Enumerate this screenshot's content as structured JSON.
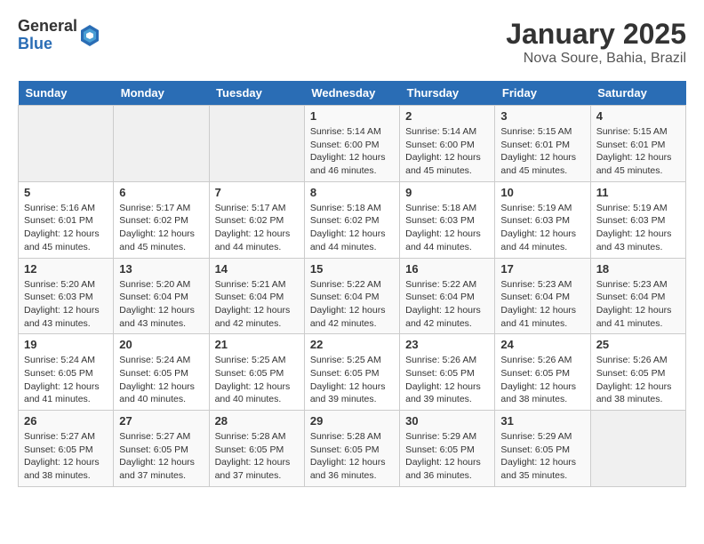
{
  "header": {
    "logo": {
      "general": "General",
      "blue": "Blue"
    },
    "title": "January 2025",
    "location": "Nova Soure, Bahia, Brazil"
  },
  "calendar": {
    "days_of_week": [
      "Sunday",
      "Monday",
      "Tuesday",
      "Wednesday",
      "Thursday",
      "Friday",
      "Saturday"
    ],
    "weeks": [
      {
        "days": [
          {
            "number": "",
            "empty": true
          },
          {
            "number": "",
            "empty": true
          },
          {
            "number": "",
            "empty": true
          },
          {
            "number": "1",
            "sunrise": "5:14 AM",
            "sunset": "6:00 PM",
            "daylight": "12 hours and 46 minutes."
          },
          {
            "number": "2",
            "sunrise": "5:14 AM",
            "sunset": "6:00 PM",
            "daylight": "12 hours and 45 minutes."
          },
          {
            "number": "3",
            "sunrise": "5:15 AM",
            "sunset": "6:01 PM",
            "daylight": "12 hours and 45 minutes."
          },
          {
            "number": "4",
            "sunrise": "5:15 AM",
            "sunset": "6:01 PM",
            "daylight": "12 hours and 45 minutes."
          }
        ]
      },
      {
        "days": [
          {
            "number": "5",
            "sunrise": "5:16 AM",
            "sunset": "6:01 PM",
            "daylight": "12 hours and 45 minutes."
          },
          {
            "number": "6",
            "sunrise": "5:17 AM",
            "sunset": "6:02 PM",
            "daylight": "12 hours and 45 minutes."
          },
          {
            "number": "7",
            "sunrise": "5:17 AM",
            "sunset": "6:02 PM",
            "daylight": "12 hours and 44 minutes."
          },
          {
            "number": "8",
            "sunrise": "5:18 AM",
            "sunset": "6:02 PM",
            "daylight": "12 hours and 44 minutes."
          },
          {
            "number": "9",
            "sunrise": "5:18 AM",
            "sunset": "6:03 PM",
            "daylight": "12 hours and 44 minutes."
          },
          {
            "number": "10",
            "sunrise": "5:19 AM",
            "sunset": "6:03 PM",
            "daylight": "12 hours and 44 minutes."
          },
          {
            "number": "11",
            "sunrise": "5:19 AM",
            "sunset": "6:03 PM",
            "daylight": "12 hours and 43 minutes."
          }
        ]
      },
      {
        "days": [
          {
            "number": "12",
            "sunrise": "5:20 AM",
            "sunset": "6:03 PM",
            "daylight": "12 hours and 43 minutes."
          },
          {
            "number": "13",
            "sunrise": "5:20 AM",
            "sunset": "6:04 PM",
            "daylight": "12 hours and 43 minutes."
          },
          {
            "number": "14",
            "sunrise": "5:21 AM",
            "sunset": "6:04 PM",
            "daylight": "12 hours and 42 minutes."
          },
          {
            "number": "15",
            "sunrise": "5:22 AM",
            "sunset": "6:04 PM",
            "daylight": "12 hours and 42 minutes."
          },
          {
            "number": "16",
            "sunrise": "5:22 AM",
            "sunset": "6:04 PM",
            "daylight": "12 hours and 42 minutes."
          },
          {
            "number": "17",
            "sunrise": "5:23 AM",
            "sunset": "6:04 PM",
            "daylight": "12 hours and 41 minutes."
          },
          {
            "number": "18",
            "sunrise": "5:23 AM",
            "sunset": "6:04 PM",
            "daylight": "12 hours and 41 minutes."
          }
        ]
      },
      {
        "days": [
          {
            "number": "19",
            "sunrise": "5:24 AM",
            "sunset": "6:05 PM",
            "daylight": "12 hours and 41 minutes."
          },
          {
            "number": "20",
            "sunrise": "5:24 AM",
            "sunset": "6:05 PM",
            "daylight": "12 hours and 40 minutes."
          },
          {
            "number": "21",
            "sunrise": "5:25 AM",
            "sunset": "6:05 PM",
            "daylight": "12 hours and 40 minutes."
          },
          {
            "number": "22",
            "sunrise": "5:25 AM",
            "sunset": "6:05 PM",
            "daylight": "12 hours and 39 minutes."
          },
          {
            "number": "23",
            "sunrise": "5:26 AM",
            "sunset": "6:05 PM",
            "daylight": "12 hours and 39 minutes."
          },
          {
            "number": "24",
            "sunrise": "5:26 AM",
            "sunset": "6:05 PM",
            "daylight": "12 hours and 38 minutes."
          },
          {
            "number": "25",
            "sunrise": "5:26 AM",
            "sunset": "6:05 PM",
            "daylight": "12 hours and 38 minutes."
          }
        ]
      },
      {
        "days": [
          {
            "number": "26",
            "sunrise": "5:27 AM",
            "sunset": "6:05 PM",
            "daylight": "12 hours and 38 minutes."
          },
          {
            "number": "27",
            "sunrise": "5:27 AM",
            "sunset": "6:05 PM",
            "daylight": "12 hours and 37 minutes."
          },
          {
            "number": "28",
            "sunrise": "5:28 AM",
            "sunset": "6:05 PM",
            "daylight": "12 hours and 37 minutes."
          },
          {
            "number": "29",
            "sunrise": "5:28 AM",
            "sunset": "6:05 PM",
            "daylight": "12 hours and 36 minutes."
          },
          {
            "number": "30",
            "sunrise": "5:29 AM",
            "sunset": "6:05 PM",
            "daylight": "12 hours and 36 minutes."
          },
          {
            "number": "31",
            "sunrise": "5:29 AM",
            "sunset": "6:05 PM",
            "daylight": "12 hours and 35 minutes."
          },
          {
            "number": "",
            "empty": true
          }
        ]
      }
    ]
  }
}
